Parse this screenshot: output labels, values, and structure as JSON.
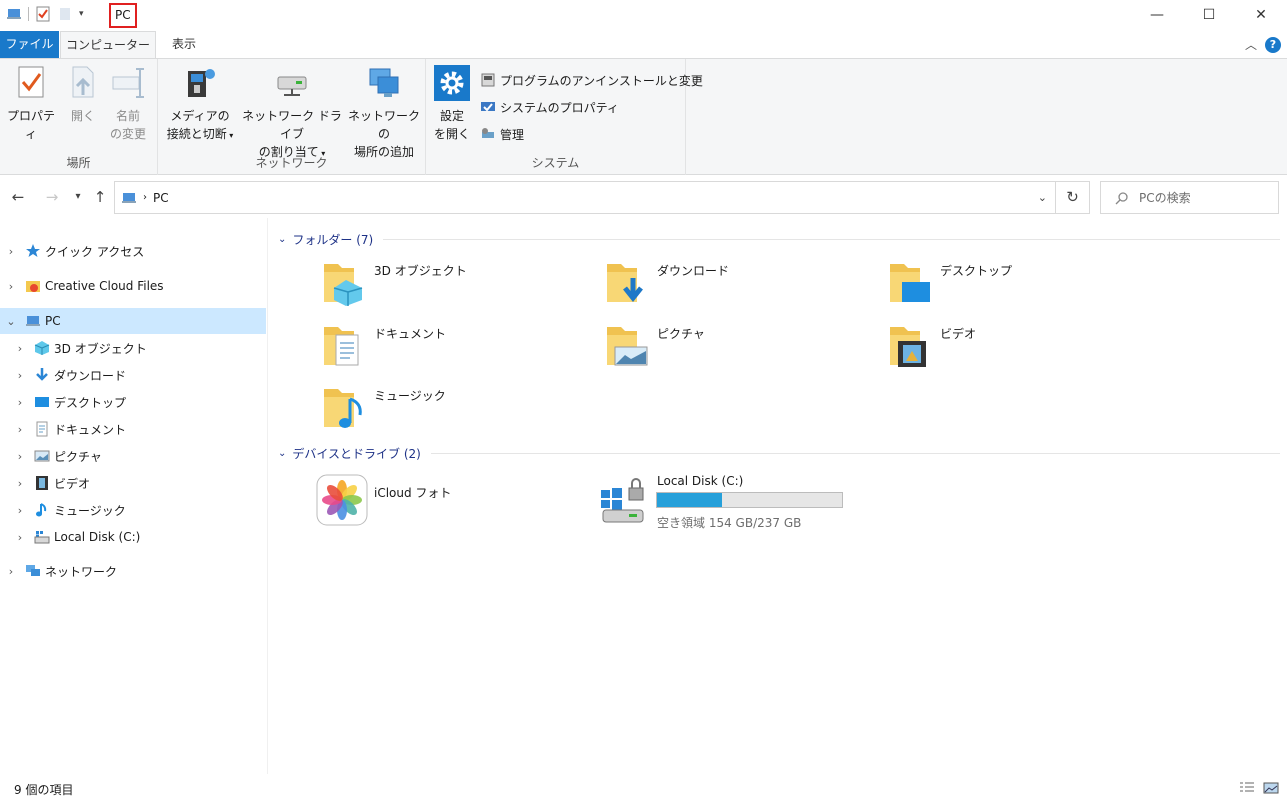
{
  "window": {
    "title": "PC",
    "minimize_glyph": "—",
    "maximize_glyph": "☐",
    "close_glyph": "✕"
  },
  "ribbon_tabs": {
    "file": "ファイル",
    "computer": "コンピューター",
    "view": "表示"
  },
  "ribbon": {
    "location": {
      "label": "場所",
      "properties": "プロパティ",
      "open": "開く",
      "rename_1": "名前",
      "rename_2": "の変更"
    },
    "network": {
      "label": "ネットワーク",
      "media_1": "メディアの",
      "media_2": "接続と切断",
      "map_drive_1": "ネットワーク ドライブ",
      "map_drive_2": "の割り当て",
      "add_location_1": "ネットワークの",
      "add_location_2": "場所の追加"
    },
    "system": {
      "label": "システム",
      "settings_1": "設定",
      "settings_2": "を開く",
      "uninstall": "プログラムのアンインストールと変更",
      "system_properties": "システムのプロパティ",
      "manage": "管理"
    }
  },
  "address": {
    "crumb": "PC",
    "search_placeholder": "PCの検索"
  },
  "sidebar": {
    "quick_access": "クイック アクセス",
    "creative_cloud": "Creative Cloud Files",
    "pc": "PC",
    "children": [
      "3D オブジェクト",
      "ダウンロード",
      "デスクトップ",
      "ドキュメント",
      "ピクチャ",
      "ビデオ",
      "ミュージック",
      "Local Disk (C:)"
    ],
    "network": "ネットワーク"
  },
  "content": {
    "folders_header": "フォルダー (7)",
    "folders": [
      "3D オブジェクト",
      "ダウンロード",
      "デスクトップ",
      "ドキュメント",
      "ピクチャ",
      "ビデオ",
      "ミュージック"
    ],
    "devices_header": "デバイスとドライブ (2)",
    "icloud": "iCloud フォト",
    "disk_name": "Local Disk (C:)",
    "disk_free": "空き領域 154 GB/237 GB",
    "disk_used_fraction": 0.35
  },
  "status": {
    "item_count": "9 個の項目"
  },
  "colors": {
    "accent": "#1979ca",
    "selection": "#cce8ff",
    "disk_fill": "#26a0da",
    "title_highlight": "#e02020"
  }
}
